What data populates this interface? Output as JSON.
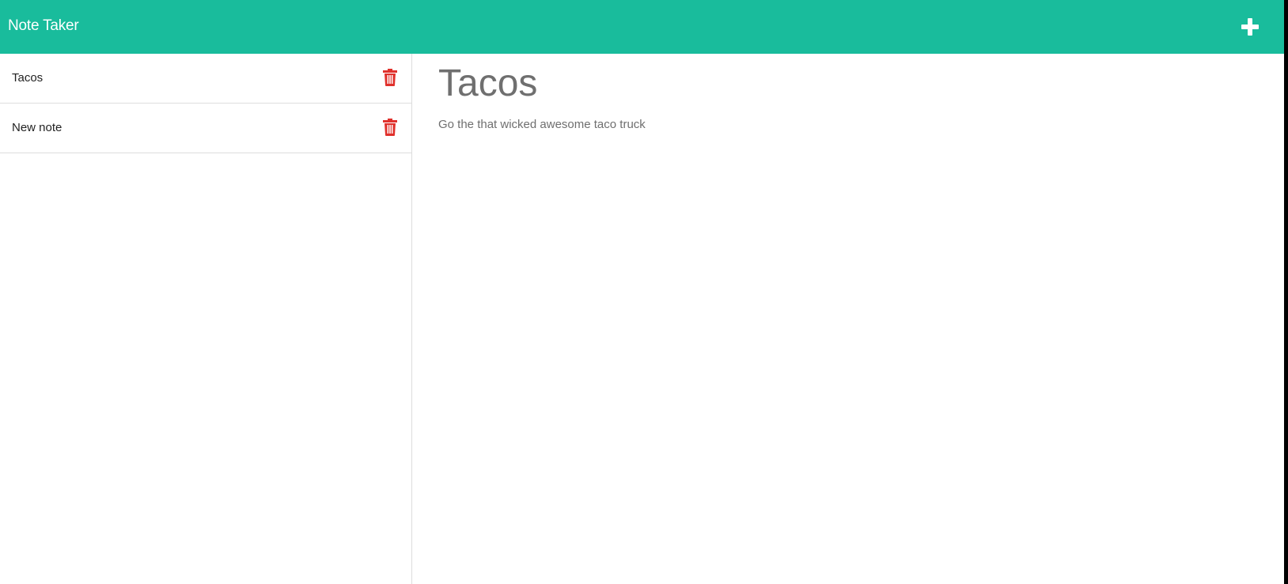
{
  "header": {
    "title": "Note Taker",
    "new_note_icon": "plus-icon"
  },
  "notes": [
    {
      "title": "Tacos",
      "delete_icon": "trash-icon"
    },
    {
      "title": "New note",
      "delete_icon": "trash-icon"
    }
  ],
  "active_note": {
    "title": "Tacos",
    "text": "Go the that wicked awesome taco truck"
  },
  "colors": {
    "header_bg": "#19bc9c",
    "delete_icon": "#e0312c",
    "editor_text": "#6f6f6f"
  }
}
